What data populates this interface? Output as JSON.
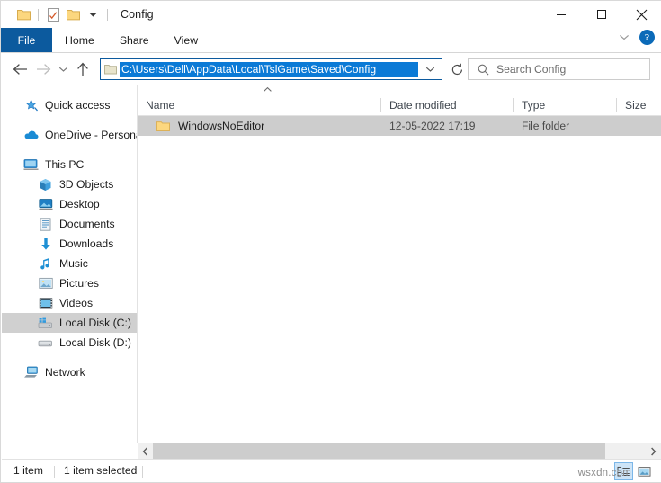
{
  "window": {
    "title": "Config",
    "quick_access_toolbar": [
      {
        "name": "pin-to-quick-access",
        "icon": "folder-icon"
      },
      {
        "name": "properties",
        "icon": "properties-checkmark-icon"
      },
      {
        "name": "new-folder",
        "icon": "folder-icon"
      },
      {
        "name": "customize-qat",
        "icon": "chevron-down-icon"
      }
    ],
    "controls": {
      "minimize": "—",
      "maximize": "□",
      "close": "✕"
    }
  },
  "ribbon": {
    "tabs": [
      {
        "label": "File",
        "active": true
      },
      {
        "label": "Home",
        "active": false
      },
      {
        "label": "Share",
        "active": false
      },
      {
        "label": "View",
        "active": false
      }
    ],
    "collapse_icon": "chevron-down-icon",
    "help_label": "?"
  },
  "navigation": {
    "back_icon": "arrow-left-icon",
    "forward_icon": "arrow-right-icon",
    "recent_icon": "chevron-down-icon",
    "up_icon": "arrow-up-icon",
    "refresh_icon": "refresh-icon",
    "address": {
      "value": "C:\\Users\\Dell\\AppData\\Local\\TslGame\\Saved\\Config",
      "selected": true,
      "dropdown_icon": "chevron-down-icon",
      "selection_color": "#0b7ad6"
    },
    "search": {
      "placeholder": "Search Config",
      "icon": "search-icon"
    }
  },
  "sidebar": {
    "items": [
      {
        "label": "Quick access",
        "icon": "star-pin-icon",
        "indent": 0,
        "selected": false
      },
      {
        "label": "OneDrive - Persona",
        "icon": "cloud-icon",
        "indent": 0,
        "selected": false
      },
      {
        "label": "This PC",
        "icon": "monitor-icon",
        "indent": 0,
        "selected": false
      },
      {
        "label": "3D Objects",
        "icon": "cube-icon",
        "indent": 1,
        "selected": false
      },
      {
        "label": "Desktop",
        "icon": "desktop-icon",
        "indent": 1,
        "selected": false
      },
      {
        "label": "Documents",
        "icon": "documents-icon",
        "indent": 1,
        "selected": false
      },
      {
        "label": "Downloads",
        "icon": "download-arrow-icon",
        "indent": 1,
        "selected": false
      },
      {
        "label": "Music",
        "icon": "music-note-icon",
        "indent": 1,
        "selected": false
      },
      {
        "label": "Pictures",
        "icon": "pictures-icon",
        "indent": 1,
        "selected": false
      },
      {
        "label": "Videos",
        "icon": "videos-film-icon",
        "indent": 1,
        "selected": false
      },
      {
        "label": "Local Disk (C:)",
        "icon": "hard-drive-windows-icon",
        "indent": 1,
        "selected": true
      },
      {
        "label": "Local Disk (D:)",
        "icon": "hard-drive-icon",
        "indent": 1,
        "selected": false
      },
      {
        "label": "Network",
        "icon": "network-icon",
        "indent": 0,
        "selected": false
      }
    ]
  },
  "file_list": {
    "sort_indicator": "ascending-caret-icon",
    "columns": [
      {
        "label": "Name"
      },
      {
        "label": "Date modified"
      },
      {
        "label": "Type"
      },
      {
        "label": "Size"
      }
    ],
    "rows": [
      {
        "name": "WindowsNoEditor",
        "date_modified": "12-05-2022 17:19",
        "type": "File folder",
        "size": "",
        "icon": "folder-icon",
        "selected": true
      }
    ]
  },
  "scrollbar": {
    "left_icon": "chevron-left-icon",
    "right_icon": "chevron-right-icon"
  },
  "status_bar": {
    "item_count": "1 item",
    "selection_count": "1 item selected",
    "view_buttons": [
      {
        "name": "details-view",
        "icon": "details-view-icon",
        "active": true
      },
      {
        "name": "large-icons-view",
        "icon": "large-icons-view-icon",
        "active": false
      }
    ]
  },
  "watermark": {
    "text": "wsxdn.com"
  }
}
